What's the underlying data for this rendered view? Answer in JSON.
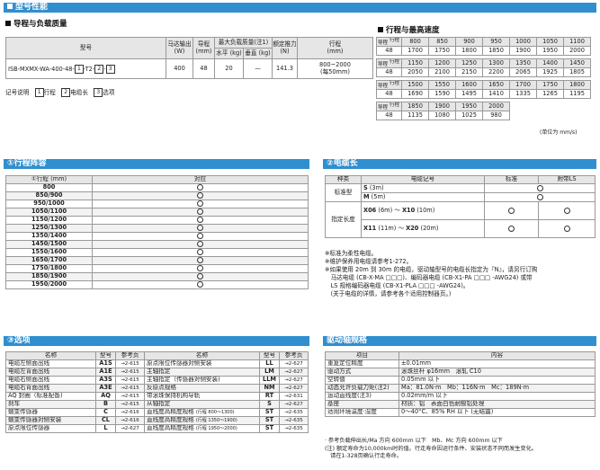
{
  "title": "型号性能",
  "guide": {
    "heading": "导程与负载质量",
    "headers": {
      "model": "型号",
      "motor_l1": "马达输出",
      "motor_l2": "(W)",
      "lead_l1": "导程",
      "lead_l2": "(mm)",
      "load": "最大负载质量(注1)",
      "load_h": "水平 (kg)",
      "load_v": "垂直 (kg)",
      "thrust_l1": "额定推力",
      "thrust_l2": "(N)",
      "stroke_l1": "行程",
      "stroke_l2": "(mm)"
    },
    "row": {
      "model_prefix": "ISB-MXMX-WA-400-48-",
      "box1": "1",
      "mid": "-T2-",
      "box2": "2",
      "sep": "-",
      "box3": "3",
      "motor": "400",
      "lead": "48",
      "horizontal": "20",
      "vertical": "—",
      "thrust": "141.3",
      "stroke_l1": "800~2000",
      "stroke_l2": "(每50mm)"
    },
    "legend": {
      "label": "记号说明",
      "items": [
        {
          "num": "1",
          "text": "行程"
        },
        {
          "num": "2",
          "text": "电缆长"
        },
        {
          "num": "3",
          "text": "选项"
        }
      ]
    }
  },
  "speed": {
    "heading": "行程与最高速度",
    "corner_top": "行程",
    "corner_bottom": "导程",
    "blocks": [
      {
        "strokes": [
          "800",
          "850",
          "900",
          "950",
          "1000",
          "1050",
          "1100"
        ],
        "lead": "48",
        "speeds": [
          "1700",
          "1750",
          "1800",
          "1850",
          "1900",
          "1950",
          "2000"
        ]
      },
      {
        "strokes": [
          "1150",
          "1200",
          "1250",
          "1300",
          "1350",
          "1400",
          "1450"
        ],
        "lead": "48",
        "speeds": [
          "2050",
          "2100",
          "2150",
          "2200",
          "2065",
          "1925",
          "1805"
        ]
      },
      {
        "strokes": [
          "1500",
          "1550",
          "1600",
          "1650",
          "1700",
          "1750",
          "1800"
        ],
        "lead": "48",
        "speeds": [
          "1690",
          "1590",
          "1495",
          "1410",
          "1335",
          "1265",
          "1195"
        ]
      },
      {
        "strokes": [
          "1850",
          "1900",
          "1950",
          "2000"
        ],
        "lead": "48",
        "speeds": [
          "1135",
          "1080",
          "1025",
          "980"
        ]
      }
    ],
    "unit": "(单位为 mm/s)"
  },
  "stroke_list": {
    "heading": "①行程阵容",
    "headers": {
      "stroke": "①行程 (mm)",
      "support": "对应"
    },
    "rows": [
      "800",
      "850/900",
      "950/1000",
      "1050/1100",
      "1150/1200",
      "1250/1300",
      "1350/1400",
      "1450/1500",
      "1550/1600",
      "1650/1700",
      "1750/1800",
      "1850/1900",
      "1950/2000"
    ]
  },
  "cable": {
    "heading": "②电缆长",
    "headers": {
      "type": "种类",
      "code": "电缆记号",
      "standard": "标准",
      "ls": "附带LS"
    },
    "standard_type": "标准型",
    "standard_rows": [
      {
        "code": "S",
        "len": "(3m)"
      },
      {
        "code": "M",
        "len": "(5m)"
      }
    ],
    "special_type": "指定长度",
    "special_rows": [
      {
        "from": "X06",
        "from_len": "(6m)",
        "to": "X10",
        "to_len": "(10m)"
      },
      {
        "from": "X11",
        "from_len": "(11m)",
        "to": "X20",
        "to_len": "(20m)"
      }
    ],
    "notes": [
      "※标准为柔性电缆。",
      "※维护保养用电缆请参考1-272。",
      "※如果使用 20m 到 30m 的电缆，驱动轴型号的电缆长指定为『N』，请另行订购",
      "　马达电缆 (CB-X-MA □□□)、编码器电缆 (CB-X1-PA □□□ -AWG24) 或带",
      "　LS 规格编码器电缆 (CB-X1-PLA □□□ -AWG24)。",
      "　(关于电缆的详情，请参考各个适用控制器页。)"
    ]
  },
  "options": {
    "heading": "③选项",
    "headers": {
      "name": "名称",
      "model": "型号",
      "ref": "参考页"
    },
    "left": [
      {
        "name": "电缆左侧面出线",
        "model": "A1S",
        "ref": "→2-615"
      },
      {
        "name": "电缆左背面出线",
        "model": "A1E",
        "ref": "→2-615"
      },
      {
        "name": "电缆右侧面出线",
        "model": "A3S",
        "ref": "→2-615"
      },
      {
        "name": "电缆右背面出线",
        "model": "A3E",
        "ref": "→2-615"
      },
      {
        "name": "AQ 封圈（标准配备)",
        "model": "AQ",
        "ref": "→2-615"
      },
      {
        "name": "刹车",
        "model": "B",
        "ref": "→2-615"
      },
      {
        "name": "蠕变传感器",
        "model": "C",
        "ref": "→2-616"
      },
      {
        "name": "蠕变传感器对侧安装",
        "model": "CL",
        "ref": "→2-616"
      },
      {
        "name": "原点限位传感器",
        "model": "L",
        "ref": "→2-627"
      }
    ],
    "right": [
      {
        "name": "原点限位传感器对侧安装",
        "sub": "",
        "model": "LL",
        "ref": "→2-627"
      },
      {
        "name": "主轴指定",
        "sub": "",
        "model": "LM",
        "ref": "→2-627"
      },
      {
        "name": "主轴指定（传感器对侧安装)",
        "sub": "",
        "model": "LLM",
        "ref": "→2-627"
      },
      {
        "name": "反原点规格",
        "sub": "",
        "model": "NM",
        "ref": "→2-627"
      },
      {
        "name": "带滚珠保持机构导轨",
        "sub": "",
        "model": "RT",
        "ref": "→2-631"
      },
      {
        "name": "从轴指定",
        "sub": "",
        "model": "S",
        "ref": "→2-627"
      },
      {
        "name": "直线度高精度规格",
        "sub": "(行程 800～1300)",
        "model": "ST",
        "ref": "→2-635"
      },
      {
        "name": "直线度高精度规格",
        "sub": "(行程 1350～1900)",
        "model": "ST",
        "ref": "→2-635"
      },
      {
        "name": "直线度高精度规格",
        "sub": "(行程 1950～2000)",
        "model": "ST",
        "ref": "→2-635"
      }
    ]
  },
  "drive": {
    "heading": "驱动轴规格",
    "headers": {
      "item": "项目",
      "content": "内容"
    },
    "rows": [
      {
        "item": "重复定位精度",
        "content": "±0.01mm"
      },
      {
        "item": "驱动方式",
        "content": "滚珠丝杆 φ16mm　滚轧 C10"
      },
      {
        "item": "空转值",
        "content": "0.05mm 以下"
      },
      {
        "item": "动态允许负载力矩(注2)",
        "content": "Ma：81.0N·m　Mb：116N·m　Mc：189N·m"
      },
      {
        "item": "运动直线度(注3)",
        "content": "0.02mm/m 以下"
      },
      {
        "item": "基座",
        "content": "材质：铝　表面白色耐酸铝处理"
      },
      {
        "item": "适用环境温度·湿度",
        "content": "0～40°C、85% RH 以下 (无结露)"
      }
    ],
    "notes": [
      "· 参考负载伸出长/Ma 方向 600mm 以下　Mb、Mc 方向 600mm 以下",
      "(注) 额定寿命为10,000km时的值。行走寿命因运行条件、安装状态不同而发生变化。",
      "　请在1-328页确认行走寿命。"
    ]
  },
  "colors": {
    "header_bg": "#2f8fcf",
    "table_head": "#e6e6e6"
  }
}
